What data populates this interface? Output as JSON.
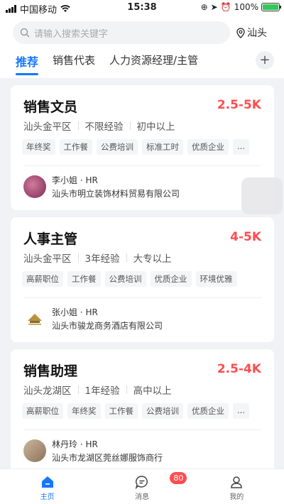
{
  "status_bar": {
    "carrier": "中国移动",
    "time": "15:38",
    "battery": "100%"
  },
  "search": {
    "placeholder": "请输入搜索关键字"
  },
  "location": "汕头",
  "tabs": [
    {
      "label": "推荐",
      "active": true
    },
    {
      "label": "销售代表",
      "active": false
    },
    {
      "label": "人力资源经理/主管",
      "active": false
    }
  ],
  "jobs": [
    {
      "title": "销售文员",
      "salary": "2.5-5K",
      "location": "汕头金平区",
      "experience": "不限经验",
      "education": "初中以上",
      "tags": [
        "年终奖",
        "工作餐",
        "公费培训",
        "标准工时",
        "优质企业",
        "..."
      ],
      "recruiter": "李小姐 · HR",
      "company": "汕头市明立装饰材料贸易有限公司"
    },
    {
      "title": "人事主管",
      "salary": "4-5K",
      "location": "汕头金平区",
      "experience": "3年经验",
      "education": "大专以上",
      "tags": [
        "高薪职位",
        "工作餐",
        "公费培训",
        "优质企业",
        "环境优雅"
      ],
      "recruiter": "张小姐 · HR",
      "company": "汕头市骏龙商务酒店有限公司"
    },
    {
      "title": "销售助理",
      "salary": "2.5-4K",
      "location": "汕头龙湖区",
      "experience": "1年经验",
      "education": "高中以上",
      "tags": [
        "高薪职位",
        "年终奖",
        "工作餐",
        "公费培训",
        "优质企业",
        "..."
      ],
      "recruiter": "林丹玲 · HR",
      "company": "汕头市龙湖区莞丝娜服饰商行"
    }
  ],
  "tabbar": [
    {
      "label": "主页",
      "icon": "home-icon",
      "active": true
    },
    {
      "label": "消息",
      "icon": "message-icon",
      "badge": "80"
    },
    {
      "label": "我的",
      "icon": "profile-icon"
    }
  ],
  "colors": {
    "accent": "#1677ff",
    "salary": "#ff4d4f"
  }
}
